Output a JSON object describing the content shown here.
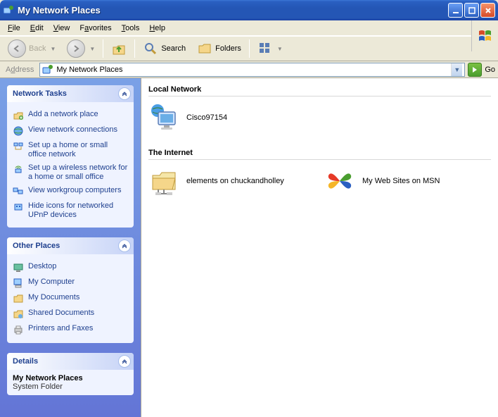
{
  "window": {
    "title": "My Network Places"
  },
  "menu": {
    "file": "File",
    "edit": "Edit",
    "view": "View",
    "favorites": "Favorites",
    "tools": "Tools",
    "help": "Help"
  },
  "toolbar": {
    "back": "Back",
    "search": "Search",
    "folders": "Folders"
  },
  "address": {
    "label": "Address",
    "value": "My Network Places",
    "go": "Go"
  },
  "sidebar": {
    "network_tasks": {
      "title": "Network Tasks",
      "items": [
        {
          "label": "Add a network place"
        },
        {
          "label": "View network connections"
        },
        {
          "label": "Set up a home or small office network"
        },
        {
          "label": "Set up a wireless network for a home or small office"
        },
        {
          "label": "View workgroup computers"
        },
        {
          "label": "Hide icons for networked UPnP devices"
        }
      ]
    },
    "other_places": {
      "title": "Other Places",
      "items": [
        {
          "label": "Desktop"
        },
        {
          "label": "My Computer"
        },
        {
          "label": "My Documents"
        },
        {
          "label": "Shared Documents"
        },
        {
          "label": "Printers and Faxes"
        }
      ]
    },
    "details": {
      "title": "Details",
      "name": "My Network Places",
      "type": "System Folder"
    }
  },
  "content": {
    "groups": [
      {
        "title": "Local Network",
        "items": [
          {
            "label": "Cisco97154"
          }
        ]
      },
      {
        "title": "The Internet",
        "items": [
          {
            "label": "elements on chuckandholley"
          },
          {
            "label": "My Web Sites on MSN"
          }
        ]
      }
    ]
  }
}
